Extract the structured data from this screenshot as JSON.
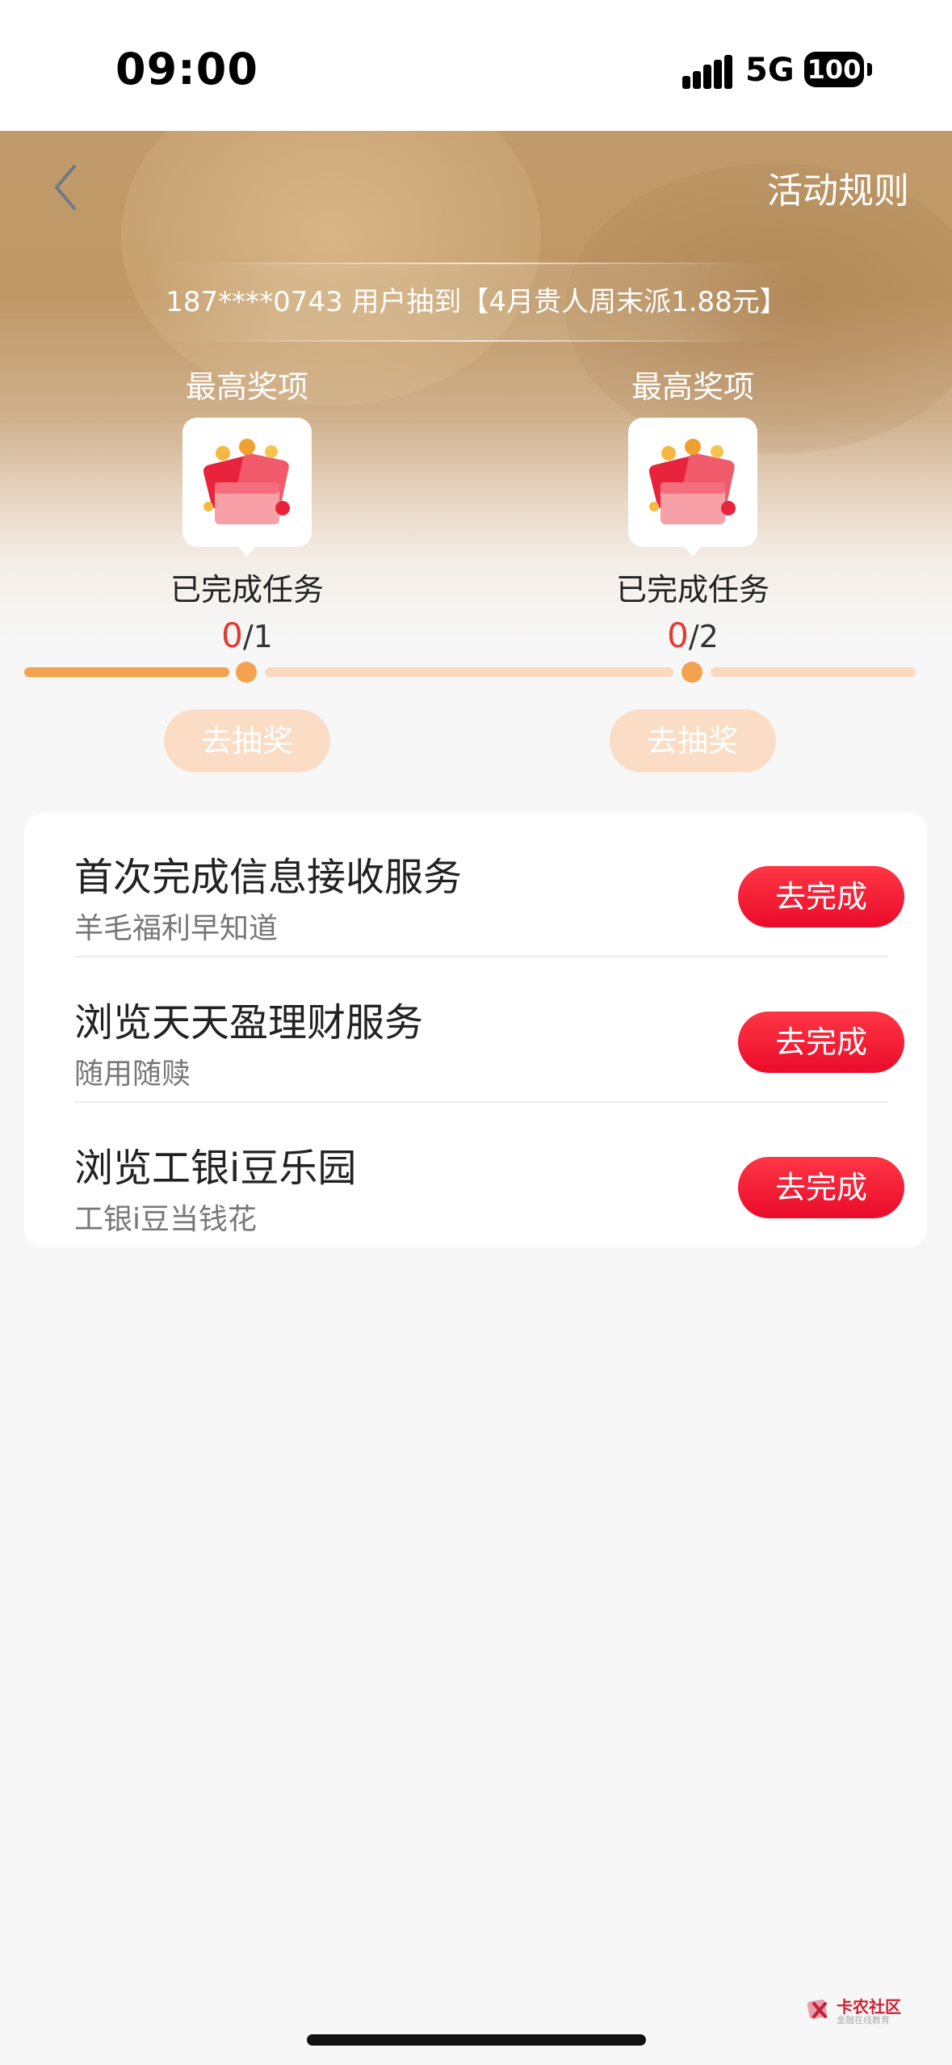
{
  "status_bar": {
    "time": "09:00",
    "network": "5G",
    "battery": "100"
  },
  "header": {
    "rules_label": "活动规则"
  },
  "ticker": {
    "text": "187****0743 用户抽到【4月贵人周末派1.88元】"
  },
  "milestones": [
    {
      "label": "最高奖项",
      "status": "已完成任务",
      "done": "0",
      "total": "/1",
      "draw_label": "去抽奖"
    },
    {
      "label": "最高奖项",
      "status": "已完成任务",
      "done": "0",
      "total": "/2",
      "draw_label": "去抽奖"
    }
  ],
  "tasks": [
    {
      "title": "首次完成信息接收服务",
      "subtitle": "羊毛福利早知道",
      "button": "去完成"
    },
    {
      "title": "浏览天天盈理财服务",
      "subtitle": "随用随赎",
      "button": "去完成"
    },
    {
      "title": "浏览工银i豆乐园",
      "subtitle": "工银i豆当钱花",
      "button": "去完成"
    }
  ],
  "watermark": {
    "name": "卡农社区",
    "tagline": "金融在线教育"
  },
  "colors": {
    "accent_red": "#ea0b2a",
    "progress_orange": "#f4a24f",
    "banner_gold": "#c09a6b"
  }
}
